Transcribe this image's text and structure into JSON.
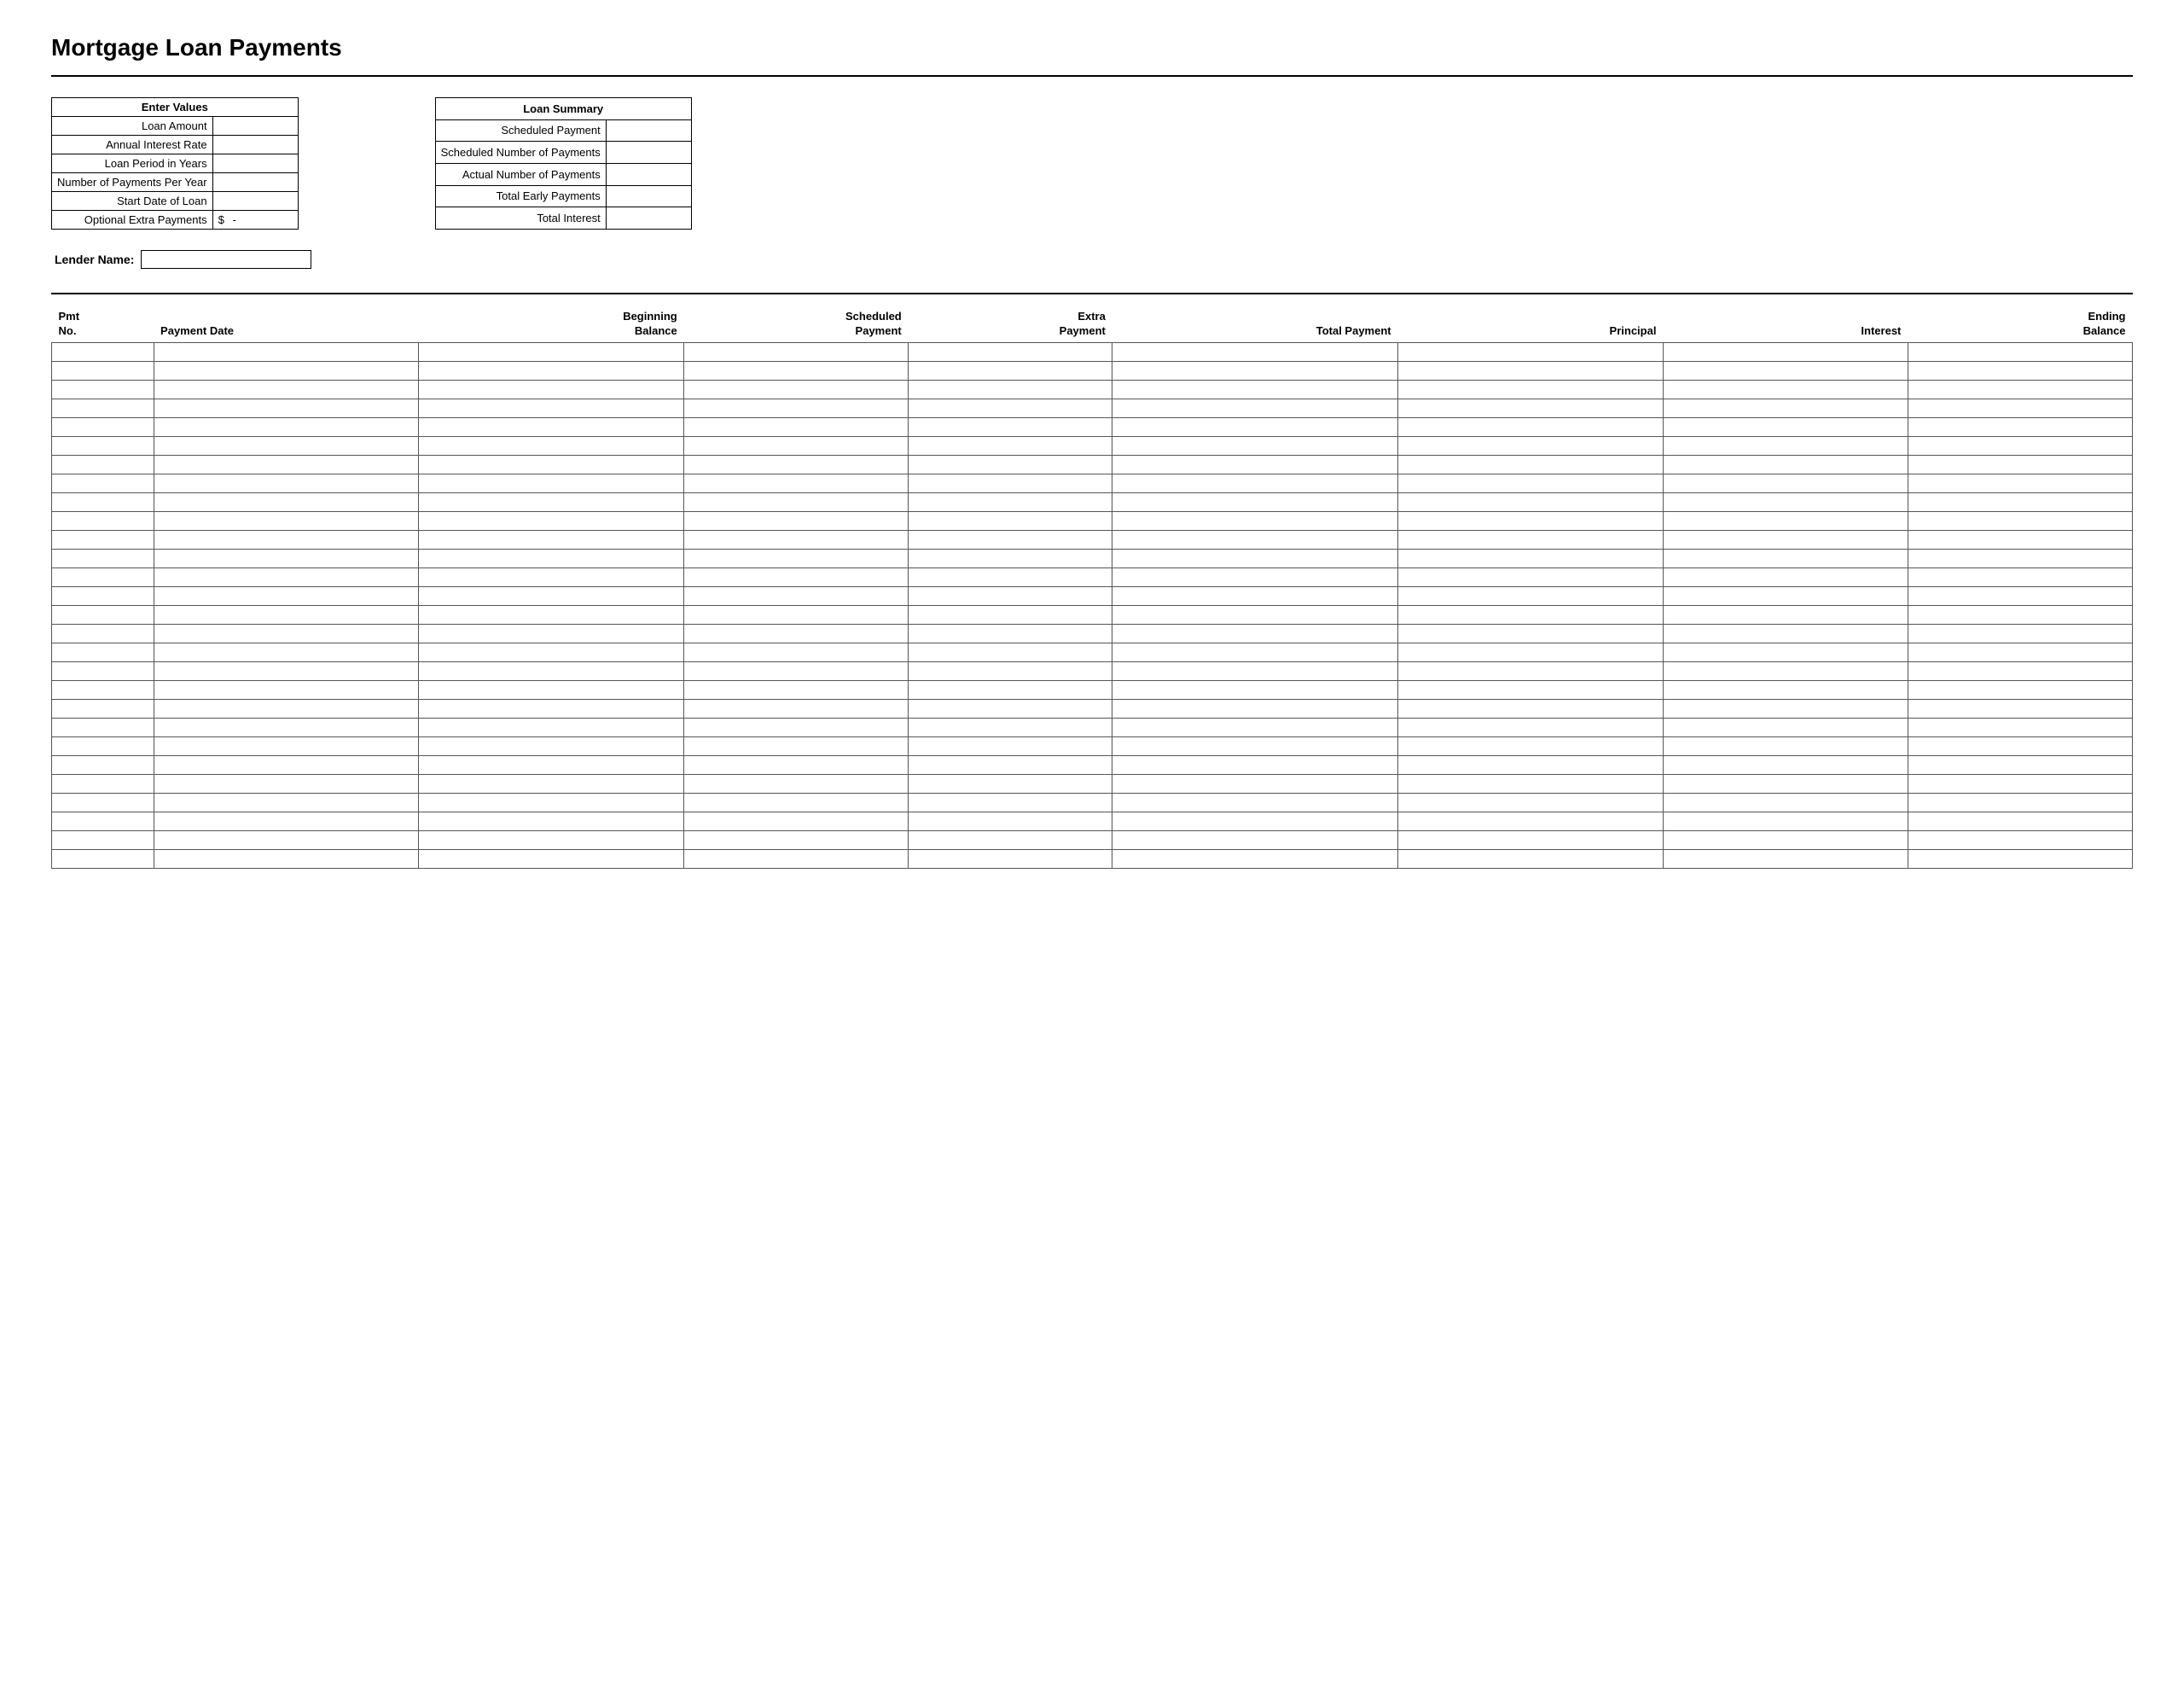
{
  "title": "Mortgage Loan Payments",
  "enterValues": {
    "header": "Enter Values",
    "fields": [
      {
        "label": "Loan Amount",
        "value": ""
      },
      {
        "label": "Annual Interest Rate",
        "value": ""
      },
      {
        "label": "Loan Period in Years",
        "value": ""
      },
      {
        "label": "Number of Payments Per Year",
        "value": ""
      },
      {
        "label": "Start Date of Loan",
        "value": ""
      },
      {
        "label": "Optional Extra Payments",
        "prefix": "$",
        "value": "-"
      }
    ]
  },
  "loanSummary": {
    "header": "Loan Summary",
    "fields": [
      {
        "label": "Scheduled Payment",
        "value": ""
      },
      {
        "label": "Scheduled Number of Payments",
        "value": ""
      },
      {
        "label": "Actual Number of Payments",
        "value": ""
      },
      {
        "label": "Total Early Payments",
        "value": ""
      },
      {
        "label": "Total Interest",
        "value": ""
      }
    ]
  },
  "lenderSection": {
    "label": "Lender Name:",
    "placeholder": ""
  },
  "table": {
    "columns": [
      {
        "id": "pmt-no",
        "line1": "Pmt",
        "line2": "No."
      },
      {
        "id": "payment-date",
        "line1": "",
        "line2": "Payment Date"
      },
      {
        "id": "beginning-balance",
        "line1": "Beginning",
        "line2": "Balance"
      },
      {
        "id": "scheduled-payment",
        "line1": "Scheduled",
        "line2": "Payment"
      },
      {
        "id": "extra-payment",
        "line1": "Extra",
        "line2": "Payment"
      },
      {
        "id": "total-payment",
        "line1": "",
        "line2": "Total Payment"
      },
      {
        "id": "principal",
        "line1": "",
        "line2": "Principal"
      },
      {
        "id": "interest",
        "line1": "",
        "line2": "Interest"
      },
      {
        "id": "ending-balance",
        "line1": "Ending",
        "line2": "Balance"
      }
    ],
    "rowCount": 28
  }
}
